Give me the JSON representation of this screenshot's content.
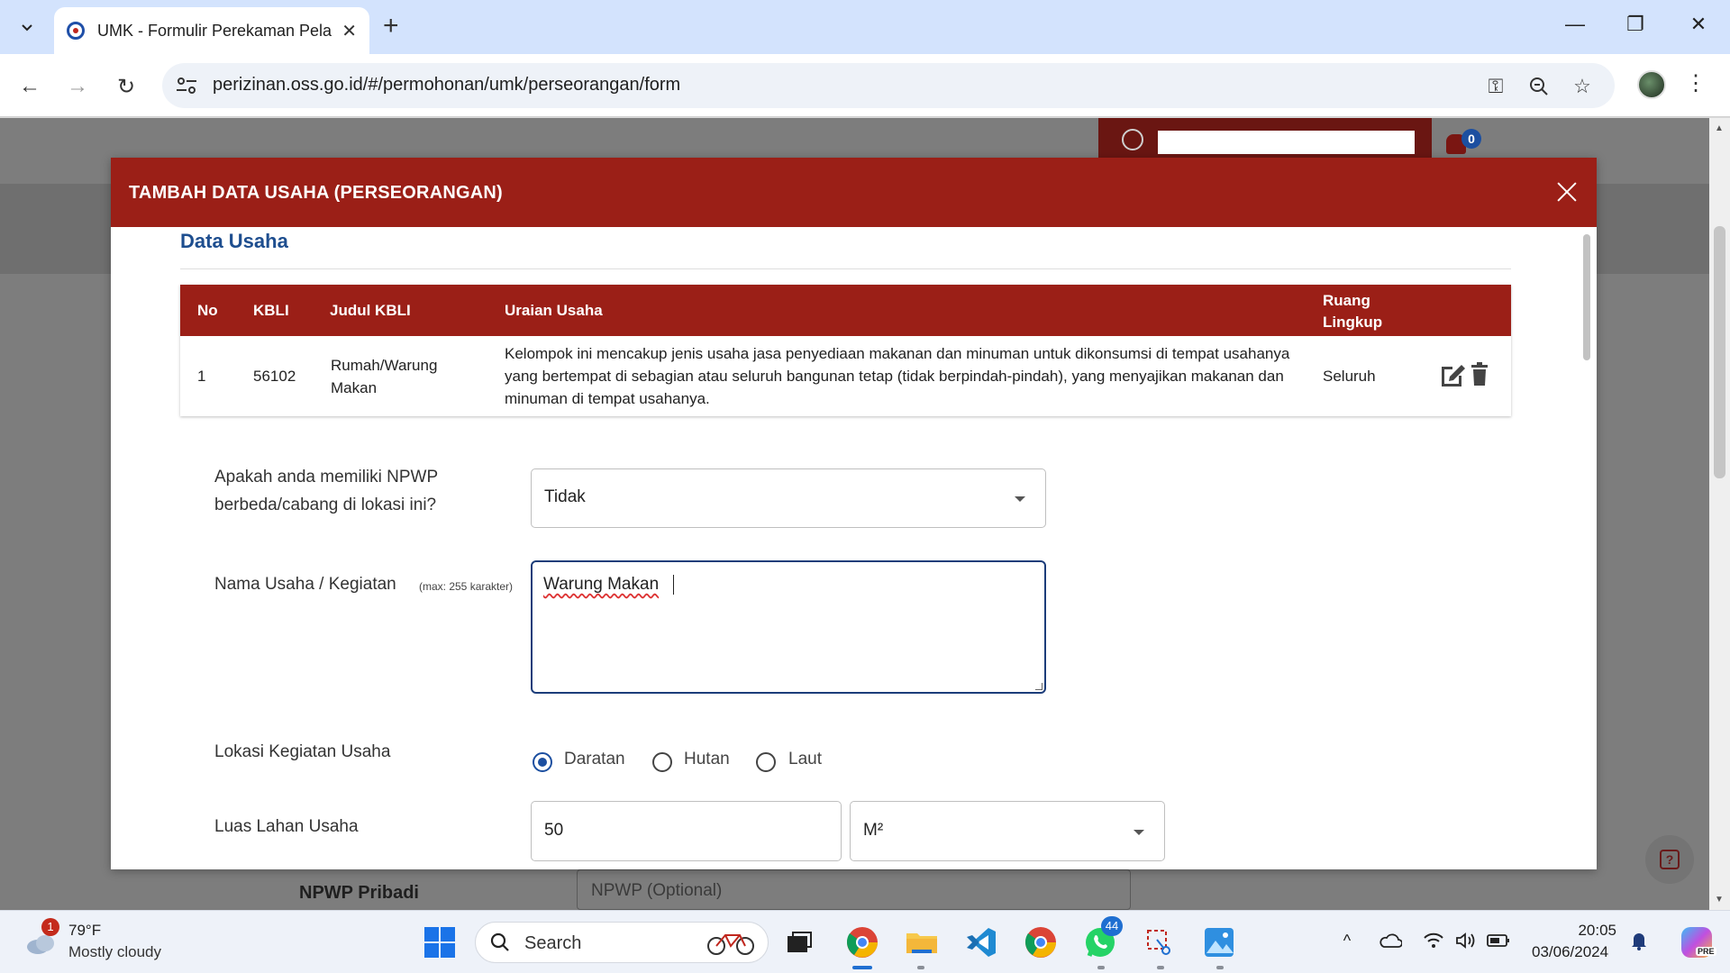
{
  "browser": {
    "tab_title": "UMK - Formulir Perekaman Pela",
    "url": "perizinan.oss.go.id/#/permohonan/umk/perseorangan/form"
  },
  "page": {
    "notification_count": "0",
    "behind_label": "NPWP Pribadi",
    "behind_placeholder": "NPWP (Optional)"
  },
  "modal": {
    "title": "TAMBAH DATA USAHA (PERSEORANGAN)",
    "section_title": "Data Usaha",
    "table": {
      "headers": [
        "No",
        "KBLI",
        "Judul KBLI",
        "Uraian Usaha",
        "Ruang Lingkup"
      ],
      "rows": [
        {
          "no": "1",
          "kbli": "56102",
          "judul": "Rumah/Warung Makan",
          "uraian": "Kelompok ini mencakup jenis usaha jasa penyediaan makanan dan minuman untuk dikonsumsi di tempat usahanya yang bertempat di sebagian atau seluruh bangunan tetap (tidak berpindah-pindah), yang menyajikan makanan dan minuman di tempat usahanya.",
          "ruang_lingkup": "Seluruh"
        }
      ]
    },
    "form": {
      "npwp_question": "Apakah anda memiliki NPWP berbeda/cabang di lokasi ini?",
      "npwp_value": "Tidak",
      "nama_label": "Nama Usaha / Kegiatan",
      "nama_hint": "(max: 255 karakter)",
      "nama_value": "Warung Makan",
      "lokasi_label": "Lokasi Kegiatan Usaha",
      "lokasi_options": [
        "Daratan",
        "Hutan",
        "Laut"
      ],
      "lokasi_selected": "Daratan",
      "luas_label": "Luas Lahan Usaha",
      "luas_value": "50",
      "luas_unit": "M²"
    }
  },
  "taskbar": {
    "weather_badge": "1",
    "weather_temp": "79°F",
    "weather_desc": "Mostly cloudy",
    "search_placeholder": "Search",
    "whatsapp_badge": "44",
    "time": "20:05",
    "date": "03/06/2024",
    "copilot_badge": "PRE"
  }
}
